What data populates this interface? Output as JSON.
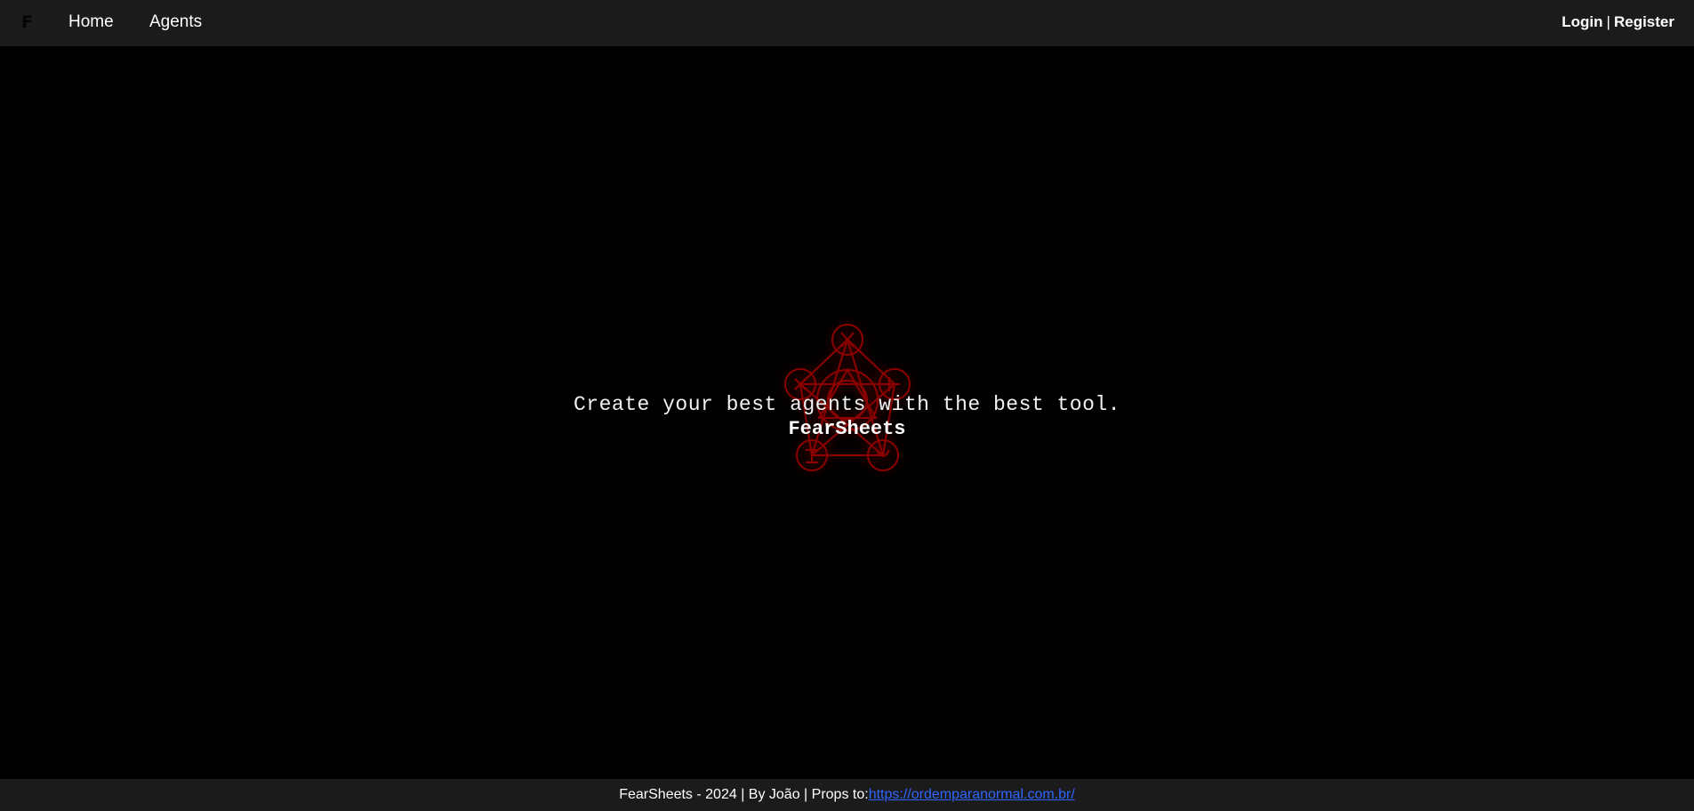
{
  "navbar": {
    "brand": "F",
    "links": [
      {
        "label": "Home"
      },
      {
        "label": "Agents"
      }
    ],
    "auth": {
      "login": "Login",
      "separator": "|",
      "register": "Register"
    }
  },
  "hero": {
    "tagline": "Create your best agents with the best tool.",
    "app_name": "FearSheets",
    "sigil_icon": "ordem-sigil-icon",
    "sigil_color": "#b00000"
  },
  "footer": {
    "text": "FearSheets - 2024 | By João | Props to:",
    "link_text": "https://ordemparanormal.com.br/"
  },
  "colors": {
    "background": "#000000",
    "navbar": "#1b1b1b",
    "text": "#ffffff",
    "link": "#2f66ff"
  }
}
